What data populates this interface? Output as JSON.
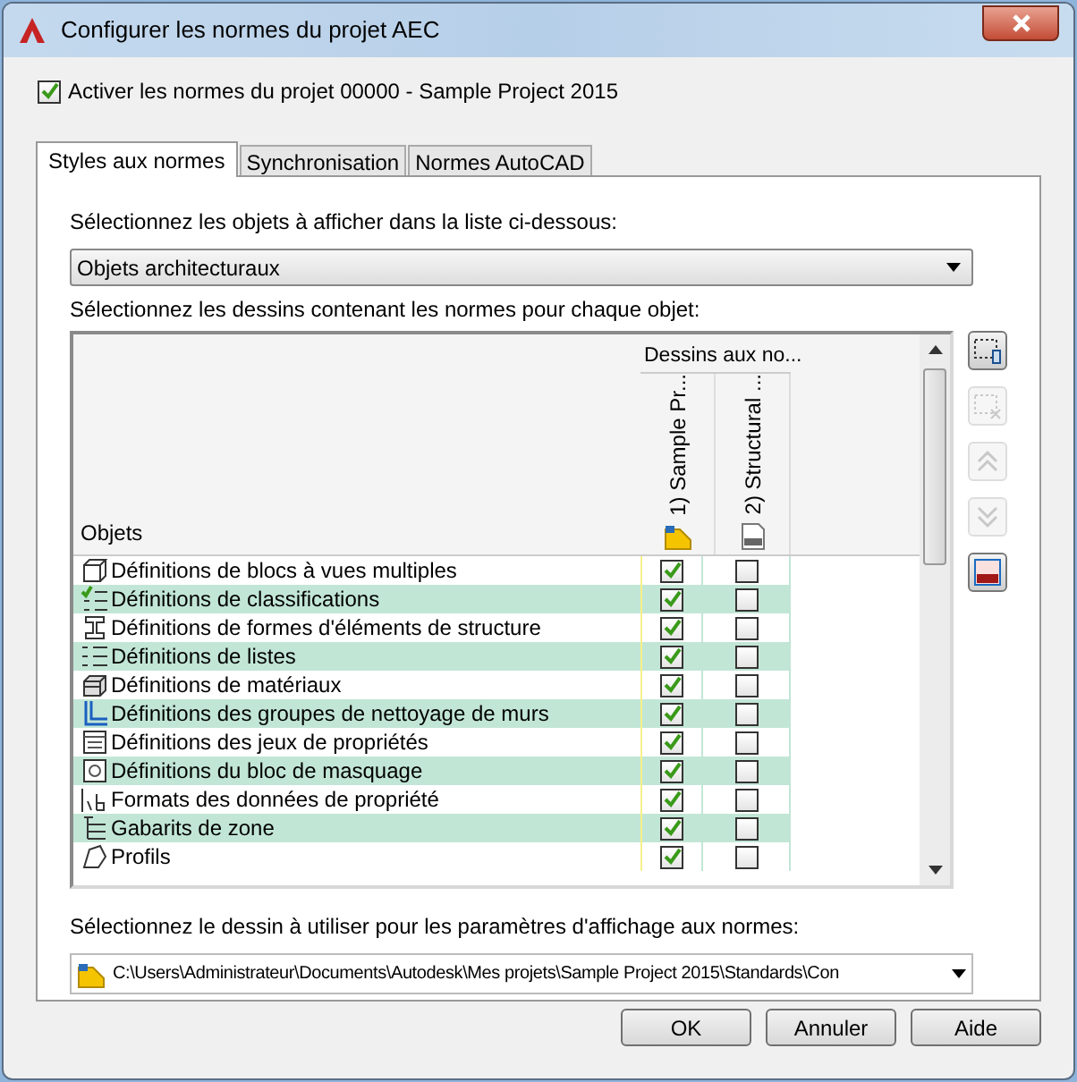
{
  "window": {
    "title": "Configurer les normes du projet AEC"
  },
  "enable": {
    "label": "Activer les normes du projet 00000 - Sample Project 2015",
    "checked": true
  },
  "tabs": [
    {
      "label": "Styles aux normes",
      "selected": true
    },
    {
      "label": "Synchronisation",
      "selected": false
    },
    {
      "label": "Normes AutoCAD",
      "selected": false
    }
  ],
  "objects_label": "Sélectionnez les objets à afficher dans la liste ci-dessous:",
  "objects_combo": {
    "value": "Objets architecturaux"
  },
  "drawings_label": "Sélectionnez les dessins contenant les normes pour chaque objet:",
  "grid": {
    "group_header": "Dessins aux no...",
    "objects_header": "Objets",
    "columns": [
      "1) Sample Pr...",
      "2) Structural ..."
    ],
    "rows": [
      {
        "name": "Définitions de blocs à vues multiples",
        "checks": [
          true,
          false
        ]
      },
      {
        "name": "Définitions de classifications",
        "checks": [
          true,
          false
        ]
      },
      {
        "name": "Définitions de formes d'éléments de structure",
        "checks": [
          true,
          false
        ]
      },
      {
        "name": "Définitions de listes",
        "checks": [
          true,
          false
        ]
      },
      {
        "name": "Définitions de matériaux",
        "checks": [
          true,
          false
        ]
      },
      {
        "name": "Définitions des groupes de nettoyage de murs",
        "checks": [
          true,
          false
        ]
      },
      {
        "name": "Définitions des jeux de propriétés",
        "checks": [
          true,
          false
        ]
      },
      {
        "name": "Définitions du bloc de masquage",
        "checks": [
          true,
          false
        ]
      },
      {
        "name": "Formats des données de propriété",
        "checks": [
          true,
          false
        ]
      },
      {
        "name": "Gabarits de zone",
        "checks": [
          true,
          false
        ]
      },
      {
        "name": "Profils",
        "checks": [
          true,
          false
        ]
      }
    ]
  },
  "side_buttons": [
    {
      "disabled": false
    },
    {
      "disabled": true
    },
    {
      "disabled": true
    },
    {
      "disabled": true
    },
    {
      "disabled": false
    }
  ],
  "display_label": "Sélectionnez le dessin à utiliser pour les paramètres d'affichage aux normes:",
  "display_combo": {
    "value": "C:\\Users\\Administrateur\\Documents\\Autodesk\\Mes projets\\Sample Project 2015\\Standards\\Con"
  },
  "buttons": [
    "OK",
    "Annuler",
    "Aide"
  ]
}
